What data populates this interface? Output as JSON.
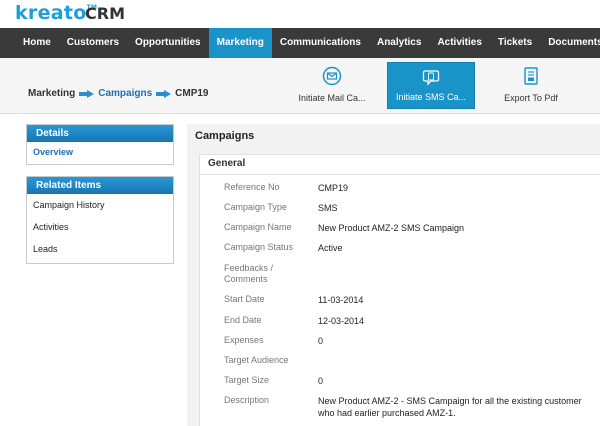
{
  "brand": {
    "logo": "kreato",
    "tm": "TM",
    "app": "CRM"
  },
  "nav": {
    "items": [
      {
        "label": "Home",
        "active": false
      },
      {
        "label": "Customers",
        "active": false
      },
      {
        "label": "Opportunities",
        "active": false
      },
      {
        "label": "Marketing",
        "active": true
      },
      {
        "label": "Communications",
        "active": false
      },
      {
        "label": "Analytics",
        "active": false
      },
      {
        "label": "Activities",
        "active": false
      },
      {
        "label": "Tickets",
        "active": false
      },
      {
        "label": "Documents",
        "active": false
      }
    ]
  },
  "breadcrumb": {
    "level1": "Marketing",
    "level2": "Campaigns",
    "level3": "CMP19"
  },
  "actions": {
    "mail": {
      "label": "Initiate Mail Ca...",
      "icon": "mail-campaign-icon"
    },
    "sms": {
      "label": "Initiate SMS Ca...",
      "icon": "sms-campaign-icon"
    },
    "pdf": {
      "label": "Export To Pdf",
      "icon": "pdf-export-icon"
    }
  },
  "sidebar": {
    "details": {
      "title": "Details",
      "items": [
        "Overview"
      ]
    },
    "related": {
      "title": "Related Items",
      "items": [
        "Campaign History",
        "Activities",
        "Leads"
      ]
    }
  },
  "main": {
    "title": "Campaigns",
    "section_title": "General",
    "fields": [
      {
        "label": "Reference No",
        "value": "CMP19"
      },
      {
        "label": "Campaign Type",
        "value": "SMS"
      },
      {
        "label": "Campaign Name",
        "value": "New Product AMZ-2 SMS Campaign"
      },
      {
        "label": "Campaign Status",
        "value": "Active"
      },
      {
        "label": "Feedbacks / Comments",
        "value": ""
      },
      {
        "label": "Start Date",
        "value": "11-03-2014"
      },
      {
        "label": "End Date",
        "value": "12-03-2014"
      },
      {
        "label": "Expenses",
        "value": "0"
      },
      {
        "label": "Target Audience",
        "value": ""
      },
      {
        "label": "Target Size",
        "value": "0"
      },
      {
        "label": "Description",
        "value": "New Product AMZ-2 - SMS Campaign for all the existing customer who had earlier purchased AMZ-1."
      }
    ]
  },
  "colors": {
    "accent": "#1a93c9",
    "nav_bg": "#3a3a3a",
    "link": "#1c6fb1"
  }
}
